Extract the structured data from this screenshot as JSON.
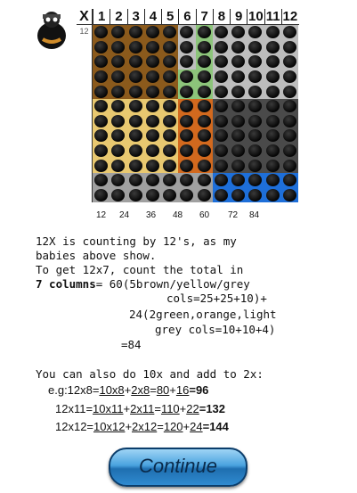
{
  "grid": {
    "corner_label": "X",
    "column_headers": [
      "1",
      "2",
      "3",
      "4",
      "5",
      "6",
      "7",
      "8",
      "9",
      "10",
      "11",
      "12"
    ],
    "row_label_first": "12",
    "rows": 12,
    "columns": 12
  },
  "multiples_row": [
    "12",
    "24",
    "36",
    "48",
    "60",
    "72",
    "84"
  ],
  "text": {
    "line1": "12X is counting by 12's, as my",
    "line2": "babies above show.",
    "line3": "To get 12x7, count the total in",
    "line4_bold": "7 columns",
    "line4_rest": "= 60(5brown/yellow/grey",
    "line5": "cols=25+25+10)+",
    "line6": "24(2green,orange,light",
    "line7": "grey cols=10+10+4)",
    "line8": "=84",
    "line9": "You can also do 10x and add to 2x:"
  },
  "examples": [
    {
      "a": "e.g:12x8=",
      "b": "10x8",
      "c": "+",
      "d": "2x8",
      "e": "=",
      "f": "80",
      "g": "+",
      "h": "16",
      "i": "=",
      "j": "96"
    },
    {
      "a": "12x11=",
      "b": "10x11",
      "c": "+",
      "d": "2x11",
      "e": "=",
      "f": "110",
      "g": "+",
      "h": "22",
      "i": "=",
      "j": "132"
    },
    {
      "a": "12x12=",
      "b": "10x12",
      "c": "+",
      "d": "2x12",
      "e": "=",
      "f": "120",
      "g": "+",
      "h": "24",
      "i": "=",
      "j": "144"
    }
  ],
  "buttons": {
    "continue_label": "Continue"
  },
  "zone_colors": {
    "brown": "#8b5a1c",
    "yellow": "#e8c870",
    "grey_left": "#a0a0a0",
    "green": "#8cc47a",
    "orange": "#d2691e",
    "light_grey": "#bdbdbd",
    "blue": "#1e6fd9",
    "dark_grey": "#4a4a4a"
  }
}
